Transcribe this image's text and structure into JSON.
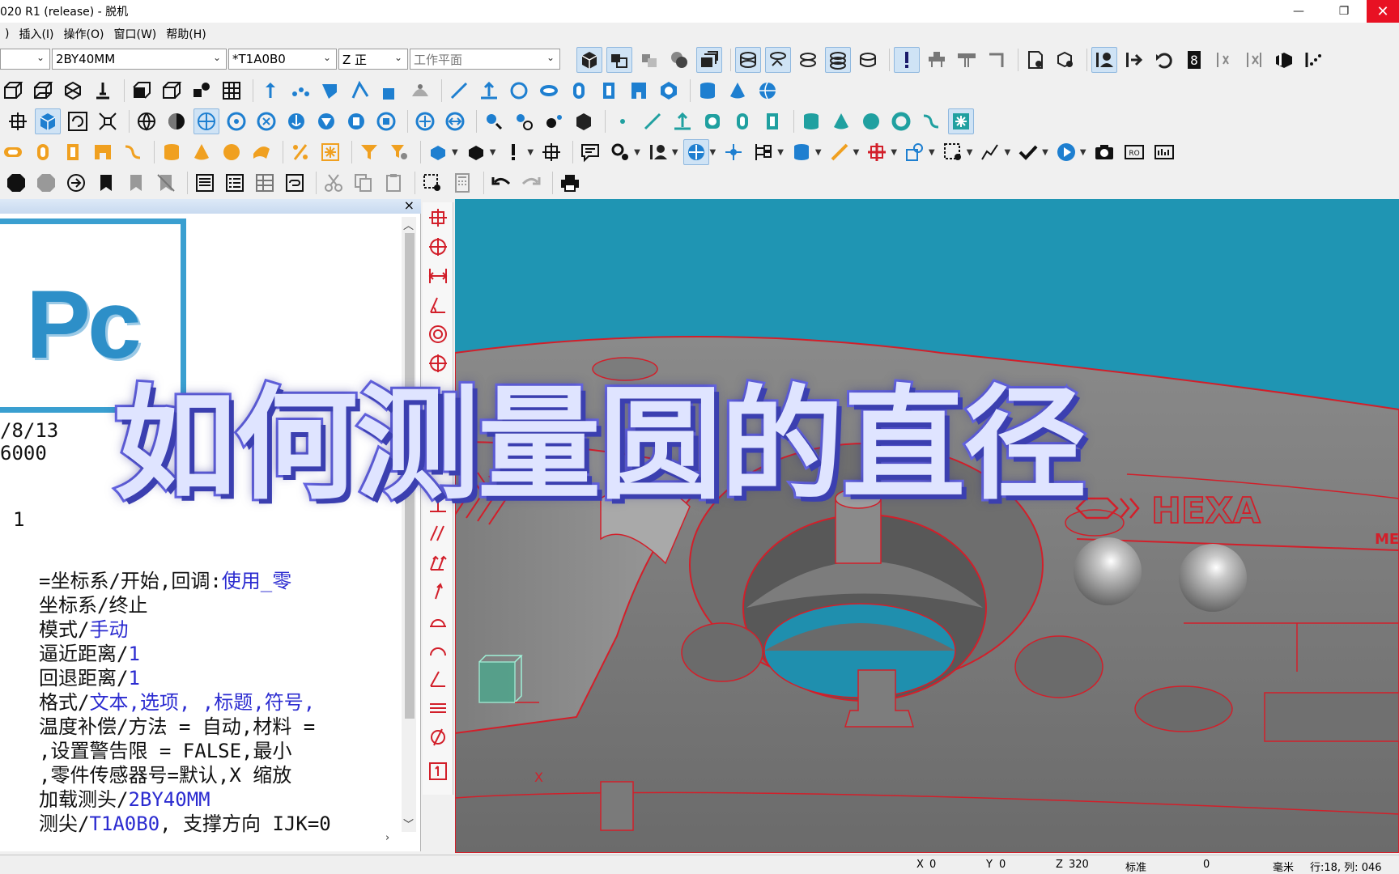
{
  "app": {
    "title": "020 R1 (release) - 脱机"
  },
  "window_controls": {
    "minimize": "—",
    "restore": "❐",
    "close": "✕"
  },
  "menu": [
    {
      "label": ")"
    },
    {
      "label": "插入(I)"
    },
    {
      "label": "操作(O)"
    },
    {
      "label": "窗口(W)"
    },
    {
      "label": "帮助(H)"
    }
  ],
  "combos": {
    "first": {
      "value": ""
    },
    "probe": {
      "value": "2BY40MM"
    },
    "tip": {
      "value": "*T1A0B0"
    },
    "axis": {
      "value": "Z 正"
    },
    "workplane": {
      "value": "工作平面"
    }
  },
  "edit_window": {
    "logo_text": "Pc",
    "date": "/8/13",
    "number": "6000",
    "line_no": "1",
    "lines": [
      {
        "pre": " =坐标系/开始,回调:",
        "kw": "使用_零",
        "post": ""
      },
      {
        "pre": "坐标系/终止",
        "kw": "",
        "post": ""
      },
      {
        "pre": "模式/",
        "kw": "手动",
        "post": ""
      },
      {
        "pre": "逼近距离/",
        "kw": "1",
        "post": ""
      },
      {
        "pre": "回退距离/",
        "kw": "1",
        "post": ""
      },
      {
        "pre": "格式/",
        "kw": "文本,选项, ,标题,符号,",
        "post": ""
      },
      {
        "pre": "温度补偿/方法 = 自动,材料 =",
        "kw": "",
        "post": ""
      },
      {
        "pre": "  ,设置警告限 = FALSE,最小",
        "kw": "",
        "post": ""
      },
      {
        "pre": "  ,零件传感器号=默认,X 缩放",
        "kw": "",
        "post": ""
      },
      {
        "pre": "加载测头/",
        "kw": "2BY40MM",
        "post": ""
      },
      {
        "pre": "测尖/",
        "kw": "T1A0B0",
        "post": ", 支撑方向 IJK=0"
      }
    ]
  },
  "viewport": {
    "brand_text": "HEXA",
    "brand_sub": "ME",
    "axis_label": "X"
  },
  "overlay_title": "如何测量圆的直径",
  "statusbar": {
    "x_label": "X",
    "x_value": "0",
    "y_label": "Y",
    "y_value": "0",
    "z_label": "Z",
    "z_value": "320",
    "mode": "标准",
    "field": "0",
    "unit": "毫米",
    "position": "行:18, 列: 046"
  },
  "colors": {
    "viewport_bg": "#1f95b3",
    "part_gray": "#7a7a7a",
    "edge_red": "#d21f2a",
    "toolbar_blue": "#1e7fd0",
    "toolbar_orange": "#f0a020",
    "overlay_fill": "#dfe4ff",
    "overlay_stroke": "#6a6ae8"
  }
}
